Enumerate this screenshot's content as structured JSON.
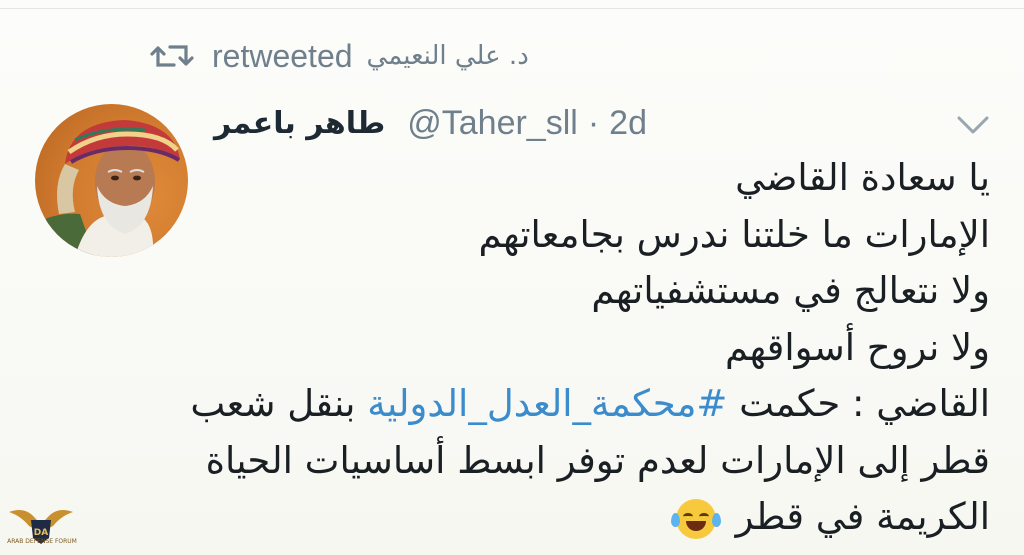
{
  "retweet": {
    "icon": "retweet-icon",
    "word": "retweeted",
    "retweeter_name": "د. علي النعيمي"
  },
  "author": {
    "display_name": "طاهر باعمر",
    "handle": "@Taher_sll",
    "separator": "·",
    "time": "2d",
    "avatar": "avatar"
  },
  "menu": {
    "icon": "chevron-down-icon"
  },
  "tweet": {
    "lines": [
      "يا سعادة القاضي",
      "الإمارات ما خلتنا ندرس بجامعاتهم",
      "ولا نتعالج في مستشفياتهم",
      "ولا نروح أسواقهم"
    ],
    "line5_before": "القاضي : حكمت ",
    "hashtag": "#محكمة_العدل_الدولية",
    "line5_after": " بنقل شعب",
    "line6": "قطر إلى الإمارات لعدم توفر ابسط أساسيات الحياة",
    "line7": "الكريمة في قطر",
    "emoji": "face-with-tears-of-joy-icon"
  },
  "watermark": {
    "logo_letters": "DA",
    "caption": "ARAB DEFENSE FORUM"
  },
  "colors": {
    "text": "#1a1f24",
    "muted": "#6f808c",
    "link": "#3b8ccc",
    "background": "#fbfbf8"
  }
}
